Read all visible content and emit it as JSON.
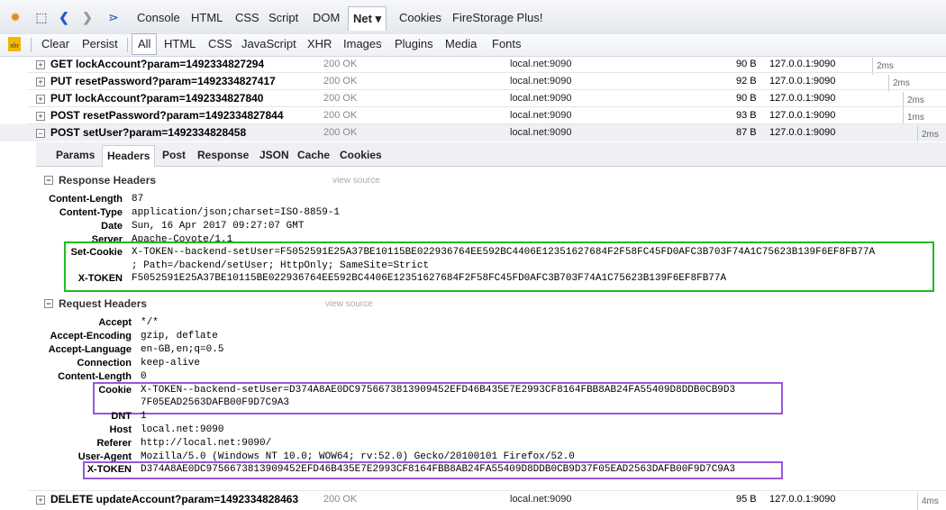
{
  "toolbar": {
    "tabs": [
      "Console",
      "HTML",
      "CSS",
      "Script",
      "DOM",
      "Net",
      "Cookies",
      "FireStorage Plus!"
    ],
    "active_tab": "Net",
    "active_arrow": "▾"
  },
  "subbar": {
    "items": [
      "Clear",
      "Persist",
      "All",
      "HTML",
      "CSS",
      "JavaScript",
      "XHR",
      "Images",
      "Plugins",
      "Media",
      "Fonts"
    ],
    "selected": "All"
  },
  "requests": [
    {
      "url": "GET lockAccount?param=1492334827294",
      "status": "200 OK",
      "domain": "local.net:9090",
      "size": "90 B",
      "ip": "127.0.0.1:9090",
      "time": "2ms"
    },
    {
      "url": "PUT resetPassword?param=1492334827417",
      "status": "200 OK",
      "domain": "local.net:9090",
      "size": "92 B",
      "ip": "127.0.0.1:9090",
      "time": "2ms"
    },
    {
      "url": "PUT lockAccount?param=1492334827840",
      "status": "200 OK",
      "domain": "local.net:9090",
      "size": "90 B",
      "ip": "127.0.0.1:9090",
      "time": "2ms"
    },
    {
      "url": "POST resetPassword?param=1492334827844",
      "status": "200 OK",
      "domain": "local.net:9090",
      "size": "93 B",
      "ip": "127.0.0.1:9090",
      "time": "1ms"
    },
    {
      "url": "POST setUser?param=1492334828458",
      "status": "200 OK",
      "domain": "local.net:9090",
      "size": "87 B",
      "ip": "127.0.0.1:9090",
      "time": "2ms"
    }
  ],
  "last_request": {
    "url": "DELETE updateAccount?param=1492334828463",
    "status": "200 OK",
    "domain": "local.net:9090",
    "size": "95 B",
    "ip": "127.0.0.1:9090",
    "time": "4ms"
  },
  "detail": {
    "tabs": [
      "Params",
      "Headers",
      "Post",
      "Response",
      "JSON",
      "Cache",
      "Cookies"
    ],
    "selected_tab": "Headers",
    "response_title": "Response Headers",
    "request_title": "Request Headers",
    "view_source": "view source",
    "response_headers": [
      {
        "k": "Content-Length",
        "v": "87"
      },
      {
        "k": "Content-Type",
        "v": "application/json;charset=ISO-8859-1"
      },
      {
        "k": "Date",
        "v": "Sun, 16 Apr 2017 09:27:07 GMT"
      },
      {
        "k": "Server",
        "v": "Apache-Coyote/1.1"
      }
    ],
    "set_cookie_key": "Set-Cookie",
    "set_cookie_line1": "X-TOKEN--backend-setUser=F5052591E25A37BE10115BE022936764EE592BC4406E12351627684F2F58FC45FD0AFC3B703F74A1C75623B139F6EF8FB77A",
    "set_cookie_line2": "; Path=/backend/setUser; HttpOnly; SameSite=Strict",
    "xtoken_resp_key": "X-TOKEN",
    "xtoken_resp_val": "F5052591E25A37BE10115BE022936764EE592BC4406E12351627684F2F58FC45FD0AFC3B703F74A1C75623B139F6EF8FB77A",
    "request_headers": [
      {
        "k": "Accept",
        "v": "*/*"
      },
      {
        "k": "Accept-Encoding",
        "v": "gzip, deflate"
      },
      {
        "k": "Accept-Language",
        "v": "en-GB,en;q=0.5"
      },
      {
        "k": "Connection",
        "v": "keep-alive"
      },
      {
        "k": "Content-Length",
        "v": "0"
      }
    ],
    "cookie_key": "Cookie",
    "cookie_line1": "X-TOKEN--backend-setUser=D374A8AE0DC9756673813909452EFD46B435E7E2993CF8164FBB8AB24FA55409D8DDB0CB9D3",
    "cookie_line2": "7F05EAD2563DAFB00F9D7C9A3",
    "request_headers2": [
      {
        "k": "DNT",
        "v": "1"
      },
      {
        "k": "Host",
        "v": "local.net:9090"
      },
      {
        "k": "Referer",
        "v": "http://local.net:9090/"
      },
      {
        "k": "User-Agent",
        "v": "Mozilla/5.0 (Windows NT 10.0; WOW64; rv:52.0) Gecko/20100101 Firefox/52.0"
      }
    ],
    "xtoken_req_key": "X-TOKEN",
    "xtoken_req_val": "D374A8AE0DC9756673813909452EFD46B435E7E2993CF8164FBB8AB24FA55409D8DDB0CB9D37F05EAD2563DAFB00F9D7C9A3"
  }
}
